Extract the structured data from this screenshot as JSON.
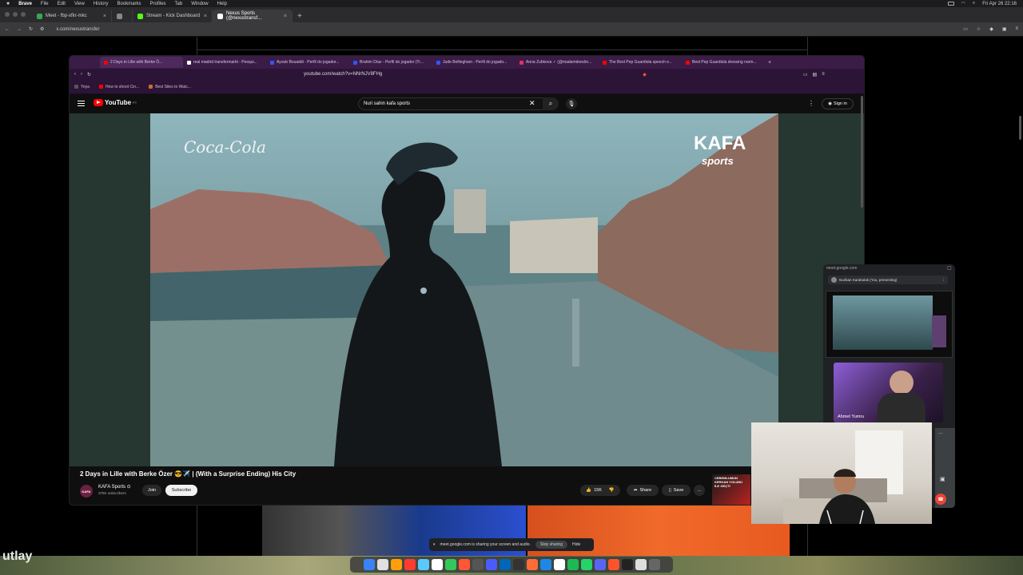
{
  "menubar": {
    "app": "Brave",
    "items": [
      "File",
      "Edit",
      "View",
      "History",
      "Bookmarks",
      "Profiles",
      "Tab",
      "Window",
      "Help"
    ],
    "clock": "Fri Apr 26 22:16"
  },
  "outer_tabs": [
    {
      "title": "Meet - fbp-xfkr-mkc",
      "color": "#34a853"
    },
    {
      "title": "",
      "color": "#888888"
    },
    {
      "title": "Stream - Kick Dashboard",
      "color": "#53fc18"
    },
    {
      "title": "Nexus Sports (@nexustransf...",
      "color": "#ffffff",
      "active": true
    }
  ],
  "outer_url": "x.com/nexustransfer",
  "inner_tabs": [
    {
      "title": "2 Days in Lille with Berke Ö...",
      "color": "#ff0000",
      "active": true
    },
    {
      "title": "real madrid transfermarkt - Pesqui...",
      "color": "#ffffff"
    },
    {
      "title": "Ayoub Bouaddi - Perfil do jogador...",
      "color": "#3355ff"
    },
    {
      "title": "Brahim Díaz - Perfil do jogador (Tr...",
      "color": "#3355ff"
    },
    {
      "title": "Jude Bellingham - Perfil do jogado...",
      "color": "#3355ff"
    },
    {
      "title": "Anna Zubkova ✓ (@madamdoedro...",
      "color": "#e1306c"
    },
    {
      "title": "The Best Pep Guardiola speech e...",
      "color": "#ff0000"
    },
    {
      "title": "Best Pep Guardiola dressing room...",
      "color": "#ff0000"
    }
  ],
  "inner_url": "youtube.com/watch?v=NNrNJV8FHg",
  "bookmarks": [
    {
      "label": "Yoya",
      "color": "#555555"
    },
    {
      "label": "How to shoot Cin...",
      "color": "#ff0000"
    },
    {
      "label": "Best Sites to Watc...",
      "color": "#d06a2a"
    }
  ],
  "youtube": {
    "logo_text": "YouTube",
    "region": "PT",
    "search_value": "Nuri sahin kafa sports",
    "sign_in": "Sign in",
    "video_title": "2 Days in Lille with Berke Özer 😎✈️ | (With a Surprise Ending) His City",
    "channel": {
      "name": "KAFA Sports ⊙",
      "subscribers": "375K subscribers",
      "avatar_text": "KAFA"
    },
    "join": "Join",
    "subscribe": "Subscribe",
    "likes": "15K",
    "share": "Share",
    "save": "Save",
    "video_watermark_left": "Coca-Cola",
    "video_watermark_right_1": "KAFA",
    "video_watermark_right_2": "sports",
    "ad_text": "CEBEMLUMUN KERKAN YOLUNU İLE GEÇTİ"
  },
  "meet": {
    "url": "meet.google.com",
    "presenting": "Nurikan Karabulak (You, presenting)",
    "participant": "Ahmet Yumru"
  },
  "share_bar": {
    "message": "meet.google.com is sharing your screen and audio.",
    "stop": "Stop sharing",
    "hide": "Hide"
  },
  "bg_text": "utlay",
  "dock_colors": [
    "#3a82f7",
    "#e0e0e0",
    "#ff9f0a",
    "#ff3b30",
    "#5ac8fa",
    "#ffffff",
    "#34c759",
    "#ff5733",
    "#555555",
    "#4a5cff",
    "#0066b8",
    "#333333",
    "#ff6c37",
    "#1e88e5",
    "#ffffff",
    "#1db954",
    "#25d366",
    "#5865f2",
    "#fb542b",
    "#222222",
    "#dddddd",
    "#666666"
  ]
}
